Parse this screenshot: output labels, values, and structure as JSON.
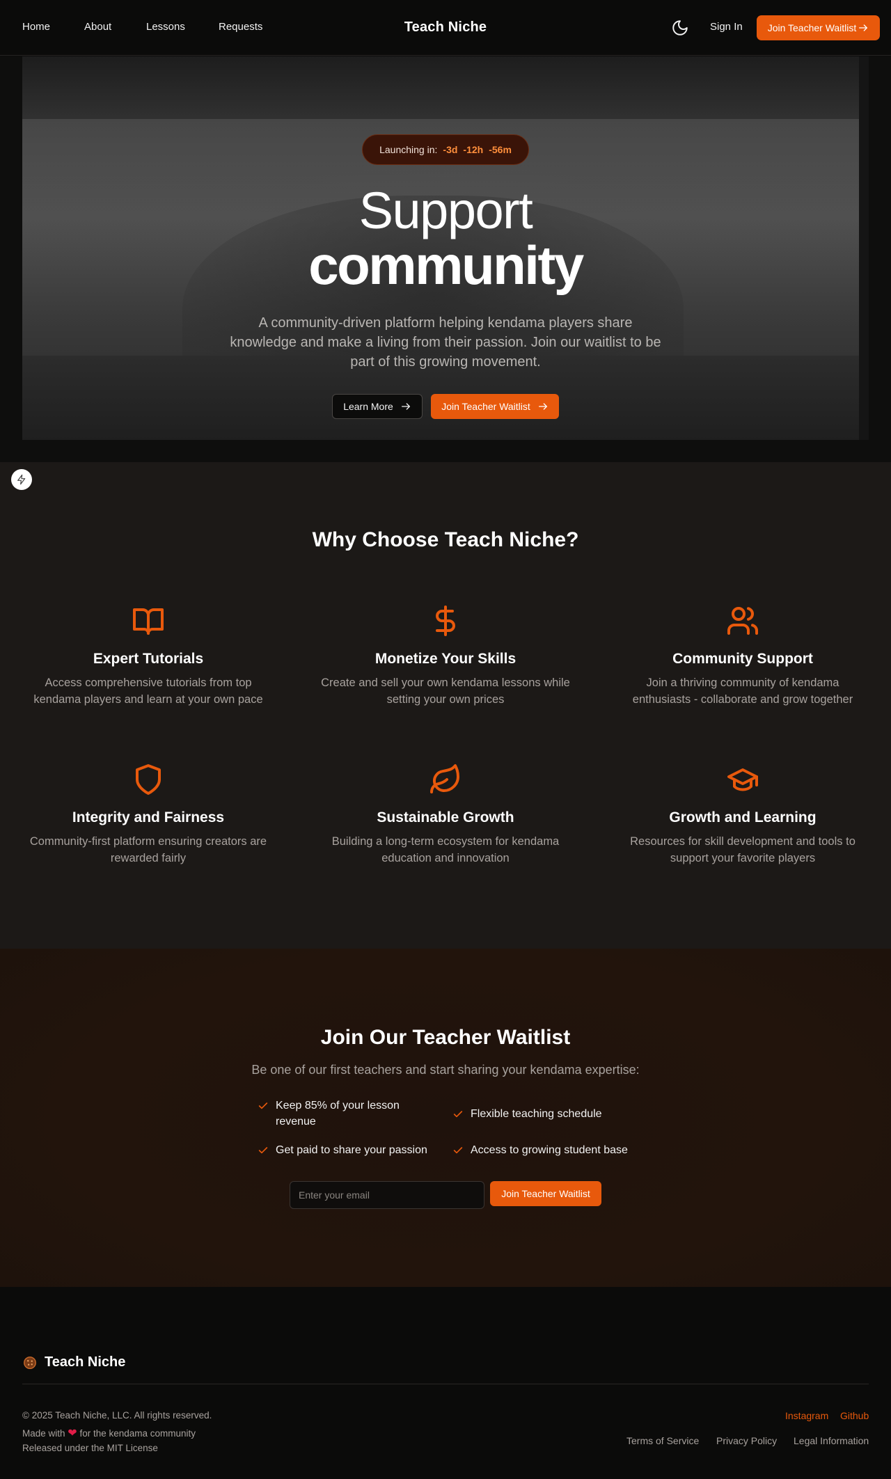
{
  "nav": {
    "links": [
      "Home",
      "About",
      "Lessons",
      "Requests"
    ],
    "brand": "Teach Niche",
    "sign_in": "Sign In",
    "cta": "Join Teacher Waitlist"
  },
  "hero": {
    "launch_label": "Launching in:",
    "countdown": [
      "-3d",
      "-12h",
      "-56m"
    ],
    "title_line1": "Support",
    "title_line2": "community",
    "subtitle": "A community-driven platform helping kendama players share knowledge and make a living from their passion. Join our waitlist to be part of this growing movement.",
    "learn_more": "Learn More",
    "cta": "Join Teacher Waitlist"
  },
  "features": {
    "title": "Why Choose Teach Niche?",
    "items": [
      {
        "icon": "book-open-icon",
        "title": "Expert Tutorials",
        "text": "Access comprehensive tutorials from top kendama players and learn at your own pace"
      },
      {
        "icon": "dollar-sign-icon",
        "title": "Monetize Your Skills",
        "text": "Create and sell your own kendama lessons while setting your own prices"
      },
      {
        "icon": "users-icon",
        "title": "Community Support",
        "text": "Join a thriving community of kendama enthusiasts - collaborate and grow together"
      },
      {
        "icon": "shield-icon",
        "title": "Integrity and Fairness",
        "text": "Community-first platform ensuring creators are rewarded fairly"
      },
      {
        "icon": "leaf-icon",
        "title": "Sustainable Growth",
        "text": "Building a long-term ecosystem for kendama education and innovation"
      },
      {
        "icon": "graduation-cap-icon",
        "title": "Growth and Learning",
        "text": "Resources for skill development and tools to support your favorite players"
      }
    ]
  },
  "waitlist": {
    "title": "Join Our Teacher Waitlist",
    "subtitle": "Be one of our first teachers and start sharing your kendama expertise:",
    "perks": [
      "Keep 85% of your lesson revenue",
      "Flexible teaching schedule",
      "Get paid to share your passion",
      "Access to growing student base"
    ],
    "email_placeholder": "Enter your email",
    "button": "Join Teacher Waitlist"
  },
  "footer": {
    "brand": "Teach Niche",
    "copyright": "© 2025 Teach Niche, LLC. All rights reserved.",
    "made_with_prefix": "Made with",
    "made_with_suffix": "for the kendama community",
    "license": "Released under the MIT License",
    "social": [
      "Instagram",
      "Github"
    ],
    "legal": [
      "Terms of Service",
      "Privacy Policy",
      "Legal Information"
    ]
  },
  "colors": {
    "accent": "#e8590c",
    "background": "#0b0b0a",
    "section": "#1c1917"
  }
}
